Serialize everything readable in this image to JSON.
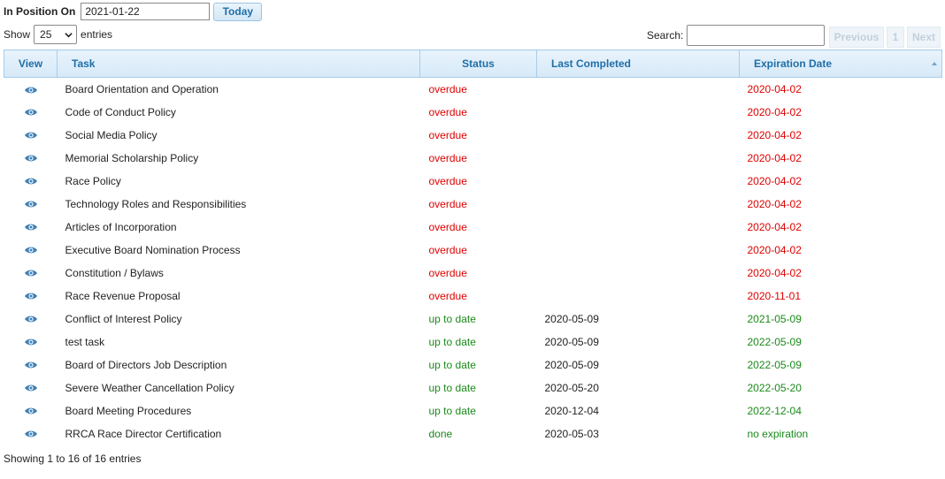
{
  "position": {
    "label": "In Position On",
    "date_value": "2021-01-22",
    "today_button": "Today"
  },
  "length": {
    "show_label": "Show",
    "selected": "25",
    "entries_label": "entries"
  },
  "search": {
    "label": "Search:",
    "value": ""
  },
  "pager": {
    "previous": "Previous",
    "page": "1",
    "next": "Next"
  },
  "table": {
    "headers": {
      "view": "View",
      "task": "Task",
      "status": "Status",
      "last_completed": "Last Completed",
      "expiration": "Expiration Date"
    },
    "rows": [
      {
        "task": "Board Orientation and Operation",
        "status": "overdue",
        "last": "",
        "exp": "2020-04-02",
        "tone": "red"
      },
      {
        "task": "Code of Conduct Policy",
        "status": "overdue",
        "last": "",
        "exp": "2020-04-02",
        "tone": "red"
      },
      {
        "task": "Social Media Policy",
        "status": "overdue",
        "last": "",
        "exp": "2020-04-02",
        "tone": "red"
      },
      {
        "task": "Memorial Scholarship Policy",
        "status": "overdue",
        "last": "",
        "exp": "2020-04-02",
        "tone": "red"
      },
      {
        "task": "Race Policy",
        "status": "overdue",
        "last": "",
        "exp": "2020-04-02",
        "tone": "red"
      },
      {
        "task": "Technology Roles and Responsibilities",
        "status": "overdue",
        "last": "",
        "exp": "2020-04-02",
        "tone": "red"
      },
      {
        "task": "Articles of Incorporation",
        "status": "overdue",
        "last": "",
        "exp": "2020-04-02",
        "tone": "red"
      },
      {
        "task": "Executive Board Nomination Process",
        "status": "overdue",
        "last": "",
        "exp": "2020-04-02",
        "tone": "red"
      },
      {
        "task": "Constitution / Bylaws",
        "status": "overdue",
        "last": "",
        "exp": "2020-04-02",
        "tone": "red"
      },
      {
        "task": "Race Revenue Proposal",
        "status": "overdue",
        "last": "",
        "exp": "2020-11-01",
        "tone": "red"
      },
      {
        "task": "Conflict of Interest Policy",
        "status": "up to date",
        "last": "2020-05-09",
        "exp": "2021-05-09",
        "tone": "green"
      },
      {
        "task": "test task",
        "status": "up to date",
        "last": "2020-05-09",
        "exp": "2022-05-09",
        "tone": "green"
      },
      {
        "task": "Board of Directors Job Description",
        "status": "up to date",
        "last": "2020-05-09",
        "exp": "2022-05-09",
        "tone": "green"
      },
      {
        "task": "Severe Weather Cancellation Policy",
        "status": "up to date",
        "last": "2020-05-20",
        "exp": "2022-05-20",
        "tone": "green"
      },
      {
        "task": "Board Meeting Procedures",
        "status": "up to date",
        "last": "2020-12-04",
        "exp": "2022-12-04",
        "tone": "green"
      },
      {
        "task": "RRCA Race Director Certification",
        "status": "done",
        "last": "2020-05-03",
        "exp": "no expiration",
        "tone": "green"
      }
    ]
  },
  "footer": {
    "info": "Showing 1 to 16 of 16 entries"
  },
  "colors": {
    "overdue": "#e00000",
    "ok": "#1a8a1a",
    "header_text": "#1f6ea8",
    "eye": "#3d7fb5"
  },
  "icons": {
    "view": "eye-icon",
    "select": "chevron-down-icon",
    "sort": "sort-ascending-icon"
  }
}
